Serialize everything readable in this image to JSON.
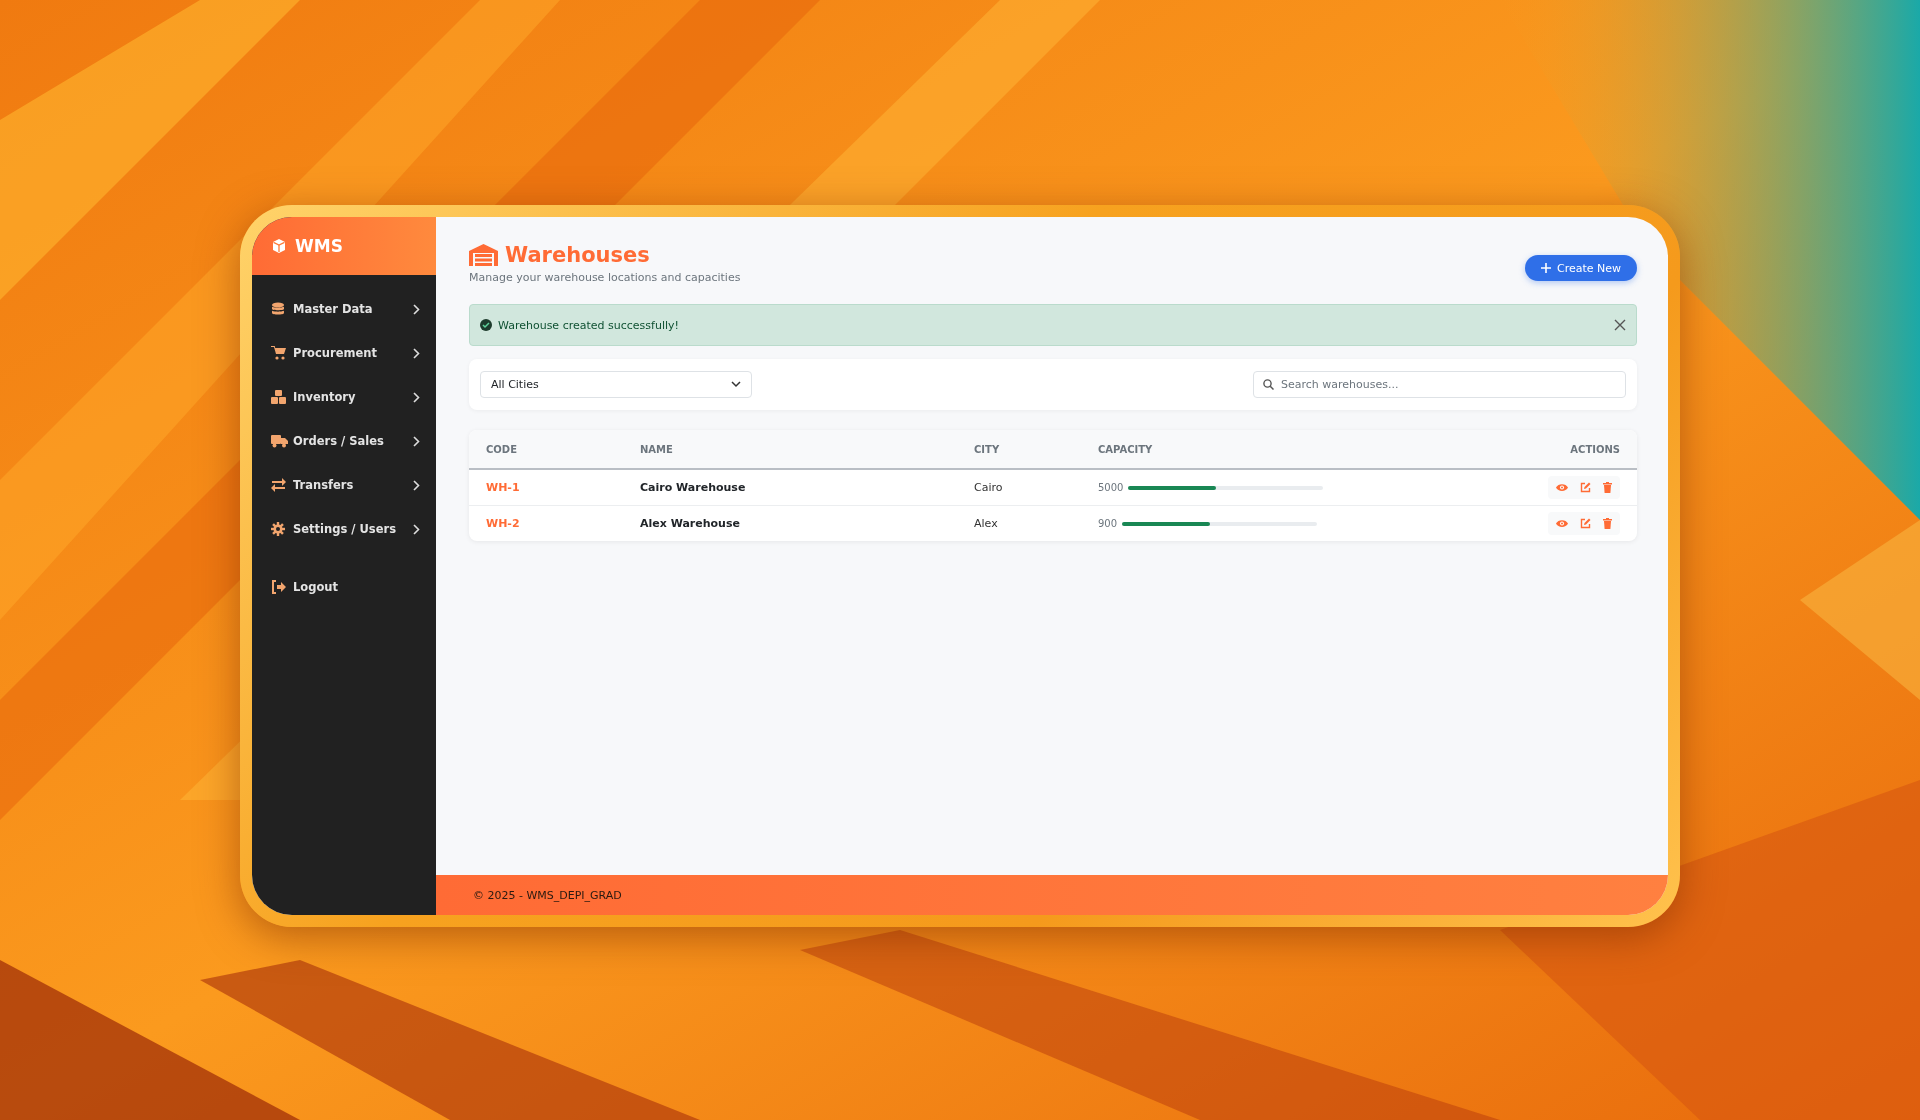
{
  "brand": "WMS",
  "sidebar": {
    "items": [
      {
        "label": "Master Data",
        "kind": "group"
      },
      {
        "label": "Procurement",
        "kind": "group"
      },
      {
        "label": "Inventory",
        "kind": "group"
      },
      {
        "label": "Orders / Sales",
        "kind": "group"
      },
      {
        "label": "Transfers",
        "kind": "group"
      },
      {
        "label": "Settings / Users",
        "kind": "group"
      },
      {
        "label": "Logout",
        "kind": "link"
      }
    ]
  },
  "page": {
    "title": "Warehouses",
    "subtitle": "Manage your warehouse locations and capacities",
    "create_button": "Create New"
  },
  "alert": {
    "message": "Warehouse created successfully!"
  },
  "filters": {
    "city": "All Cities",
    "search": {
      "placeholder": "Search warehouses..."
    }
  },
  "table": {
    "columns": [
      "CODE",
      "NAME",
      "CITY",
      "CAPACITY",
      "ACTIONS"
    ],
    "rows": [
      {
        "code": "WH-1",
        "name": "Cairo Warehouse",
        "city": "Cairo",
        "capacity": "5000",
        "level": 0.45
      },
      {
        "code": "WH-2",
        "name": "Alex Warehouse",
        "city": "Alex",
        "capacity": "900",
        "level": 0.45
      }
    ]
  },
  "footer": "© 2025 - WMS_DEPI_GRAD"
}
